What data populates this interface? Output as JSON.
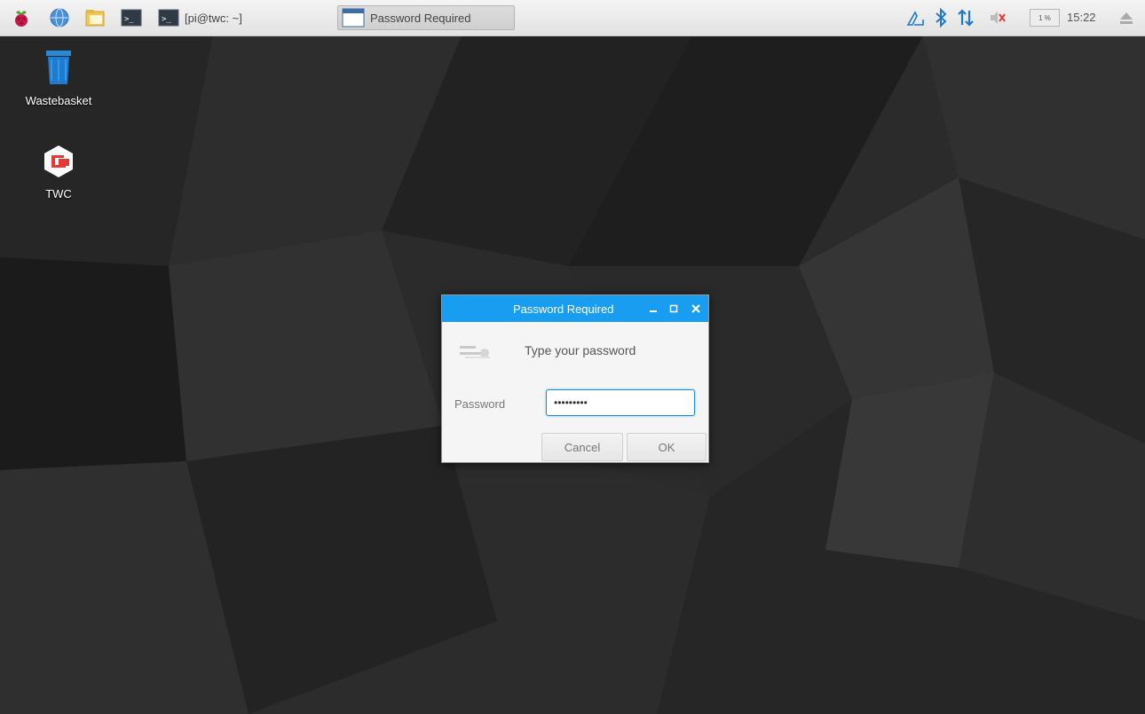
{
  "taskbar": {
    "launchers": [
      {
        "icon": "raspberry-menu-icon"
      },
      {
        "icon": "web-browser-icon"
      },
      {
        "icon": "file-manager-icon"
      },
      {
        "icon": "terminal-icon"
      }
    ],
    "tasks": [
      {
        "label": "[pi@twc: ~]",
        "icon": "terminal-icon"
      },
      {
        "label": "Password Required",
        "icon": "window-icon",
        "active": true
      }
    ],
    "tray": {
      "cpu_label": "1 %",
      "clock": "15:22",
      "icons": [
        "vnc-icon",
        "bluetooth-icon",
        "network-icon",
        "volume-muted-icon",
        "eject-icon"
      ]
    }
  },
  "desktop": {
    "icons": [
      {
        "label": "Wastebasket",
        "icon": "trash-icon"
      },
      {
        "label": "TWC",
        "icon": "twc-app-icon"
      }
    ]
  },
  "dialog": {
    "title": "Password Required",
    "prompt": "Type your password",
    "password_label": "Password",
    "password_value": "•••••••••",
    "cancel_label": "Cancel",
    "ok_label": "OK",
    "titlebar_buttons": [
      "minimize-icon",
      "maximize-icon",
      "close-icon"
    ]
  },
  "colors": {
    "accent": "#199df0",
    "taskbar": "#ececec",
    "desktop": "#2a2a2a"
  }
}
